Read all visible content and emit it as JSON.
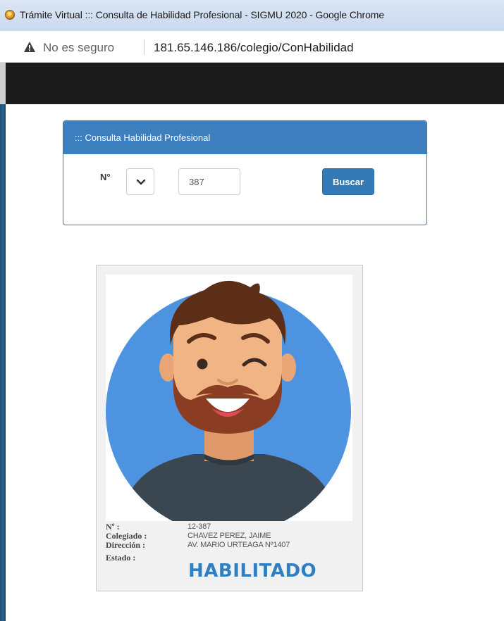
{
  "window": {
    "title": "Trámite Virtual ::: Consulta de Habilidad Profesional - SIGMU 2020 - Google Chrome"
  },
  "address_bar": {
    "security_label": "No es seguro",
    "url": "181.65.146.186/colegio/ConHabilidad"
  },
  "panel": {
    "heading": "::: Consulta Habilidad Profesional",
    "number_label": "N°",
    "number_value": "387",
    "search_button": "Buscar"
  },
  "card": {
    "fields": [
      {
        "label": "Nº :",
        "value": "12-387"
      },
      {
        "label": "Colegiado :",
        "value": "CHAVEZ PEREZ, JAIME"
      },
      {
        "label": "Dirección :",
        "value": "AV. MARIO URTEAGA Nº1407"
      },
      {
        "label": "Estado :",
        "value": "HABILITADO"
      }
    ]
  },
  "colors": {
    "accent": "#337ab7",
    "status": "#2f7fc1",
    "avatar_background": "#4d93e0"
  }
}
